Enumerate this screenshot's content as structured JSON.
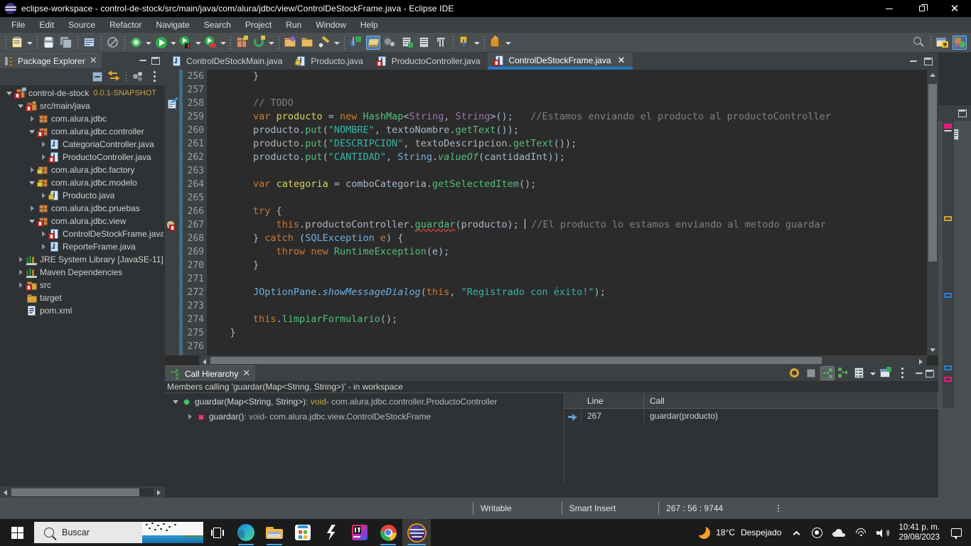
{
  "window": {
    "title": "eclipse-workspace - control-de-stock/src/main/java/com/alura/jdbc/view/ControlDeStockFrame.java - Eclipse IDE",
    "app_icon": "eclipse-icon",
    "minimize_label": "Minimize",
    "restore_label": "Restore",
    "close_label": "Close"
  },
  "menubar": {
    "items": [
      {
        "label": "File",
        "mnemonic": "F"
      },
      {
        "label": "Edit",
        "mnemonic": "E"
      },
      {
        "label": "Source",
        "mnemonic": "S"
      },
      {
        "label": "Refactor",
        "mnemonic": "t"
      },
      {
        "label": "Navigate",
        "mnemonic": "N"
      },
      {
        "label": "Search",
        "mnemonic": "a"
      },
      {
        "label": "Project",
        "mnemonic": "P"
      },
      {
        "label": "Run",
        "mnemonic": "R"
      },
      {
        "label": "Window",
        "mnemonic": "W"
      },
      {
        "label": "Help",
        "mnemonic": "H"
      }
    ]
  },
  "toolbar": {
    "icons": [
      "new-wizard-icon",
      "save-icon",
      "save-all-icon",
      "print-icon",
      "no-entry-icon",
      "debug-icon",
      "run-icon",
      "run-coverage-icon",
      "run-external-tools-icon",
      "new-java-project-icon",
      "refresh-icon",
      "open-type-icon",
      "open-task-icon",
      "edit-icon",
      "skip-breakpoints-icon",
      "java-perspective-icon",
      "search-icon",
      "next-annotation-icon",
      "previous-annotation-icon",
      "last-edit-location-icon",
      "back-icon",
      "forward-icon",
      "new-window-icon",
      "search-magnifier-icon",
      "open-perspective-icon",
      "java-ee-perspective-icon"
    ]
  },
  "package_explorer": {
    "tab_title": "Package Explorer",
    "tab_icon": "package-explorer-icon",
    "close_icon": "close-icon",
    "minimize_icon": "minimize-icon",
    "maximize_icon": "maximize-icon",
    "view_buttons": [
      "collapse-all-icon",
      "link-with-editor-icon",
      "view-menu-icon",
      "view-options-icon"
    ],
    "tree": [
      {
        "indent": 0,
        "twisty": "down",
        "icon": "java-project-error-icon",
        "label": "control-de-stock",
        "version": "0.0.1-SNAPSHOT"
      },
      {
        "indent": 1,
        "twisty": "down",
        "icon": "source-folder-error-icon",
        "label": "src/main/java",
        "version": ""
      },
      {
        "indent": 2,
        "twisty": "right",
        "icon": "package-icon",
        "label": "com.alura.jdbc",
        "version": ""
      },
      {
        "indent": 2,
        "twisty": "down",
        "icon": "package-error-icon",
        "label": "com.alura.jdbc.controller",
        "version": ""
      },
      {
        "indent": 3,
        "twisty": "right",
        "icon": "java-file-icon",
        "label": "CategoriaController.java",
        "version": ""
      },
      {
        "indent": 3,
        "twisty": "right",
        "icon": "java-file-error-icon",
        "label": "ProductoController.java",
        "version": ""
      },
      {
        "indent": 2,
        "twisty": "right",
        "icon": "package-lock-icon",
        "label": "com.alura.jdbc.factory",
        "version": ""
      },
      {
        "indent": 2,
        "twisty": "down",
        "icon": "package-lock-icon",
        "label": "com.alura.jdbc.modelo",
        "version": ""
      },
      {
        "indent": 3,
        "twisty": "right",
        "icon": "java-file-lock-icon",
        "label": "Producto.java",
        "version": ""
      },
      {
        "indent": 2,
        "twisty": "right",
        "icon": "package-icon",
        "label": "com.alura.jdbc.pruebas",
        "version": ""
      },
      {
        "indent": 2,
        "twisty": "down",
        "icon": "package-error-icon",
        "label": "com.alura.jdbc.view",
        "version": ""
      },
      {
        "indent": 3,
        "twisty": "right",
        "icon": "java-file-error-icon",
        "label": "ControlDeStockFrame.java",
        "version": ""
      },
      {
        "indent": 3,
        "twisty": "right",
        "icon": "java-file-icon",
        "label": "ReporteFrame.java",
        "version": ""
      },
      {
        "indent": 1,
        "twisty": "right",
        "icon": "library-icon",
        "label": "JRE System Library [JavaSE-11]",
        "version": ""
      },
      {
        "indent": 1,
        "twisty": "right",
        "icon": "library-icon",
        "label": "Maven Dependencies",
        "version": ""
      },
      {
        "indent": 1,
        "twisty": "right",
        "icon": "folder-error-icon",
        "label": "src",
        "version": ""
      },
      {
        "indent": 1,
        "twisty": "none",
        "icon": "folder-icon",
        "label": "target",
        "version": ""
      },
      {
        "indent": 1,
        "twisty": "none",
        "icon": "xml-file-icon",
        "label": "pom.xml",
        "version": ""
      }
    ]
  },
  "editor": {
    "tabs": [
      {
        "label": "ControlDeStockMain.java",
        "icon": "java-file-icon",
        "active": false,
        "closable": false
      },
      {
        "label": "Producto.java",
        "icon": "java-file-lock-icon",
        "active": false,
        "closable": false
      },
      {
        "label": "ProductoController.java",
        "icon": "java-file-error-icon",
        "active": false,
        "closable": false
      },
      {
        "label": "ControlDeStockFrame.java",
        "icon": "java-file-error-icon",
        "active": true,
        "closable": true
      }
    ],
    "close_icon": "close-icon",
    "minimize_icon": "minimize-icon",
    "maximize_icon": "maximize-icon",
    "first_line": 256,
    "lines": [
      {
        "n": 256,
        "marker": "",
        "segments": [
          {
            "t": "        }",
            "c": "pun"
          }
        ]
      },
      {
        "n": 257,
        "marker": "",
        "segments": []
      },
      {
        "n": 258,
        "marker": "todo-icon",
        "segments": [
          {
            "t": "        // TODO",
            "c": "cmt"
          }
        ]
      },
      {
        "n": 259,
        "marker": "",
        "segments": [
          {
            "t": "        ",
            "c": "pun"
          },
          {
            "t": "var",
            "c": "k"
          },
          {
            "t": " ",
            "c": "pun"
          },
          {
            "t": "producto",
            "c": "var"
          },
          {
            "t": " = ",
            "c": "pun"
          },
          {
            "t": "new",
            "c": "k"
          },
          {
            "t": " ",
            "c": "pun"
          },
          {
            "t": "HashMap",
            "c": "grn"
          },
          {
            "t": "<",
            "c": "pun"
          },
          {
            "t": "String",
            "c": "fld"
          },
          {
            "t": ", ",
            "c": "pun"
          },
          {
            "t": "String",
            "c": "fld"
          },
          {
            "t": ">();",
            "c": "pun"
          },
          {
            "t": "   //Estamos enviando el producto al productoController",
            "c": "cmt"
          }
        ]
      },
      {
        "n": 260,
        "marker": "",
        "segments": [
          {
            "t": "        producto.",
            "c": "pun"
          },
          {
            "t": "put",
            "c": "grn"
          },
          {
            "t": "(",
            "c": "pun"
          },
          {
            "t": "\"NOMBRE\"",
            "c": "tealk"
          },
          {
            "t": ", textoNombre.",
            "c": "pun"
          },
          {
            "t": "getText",
            "c": "grn"
          },
          {
            "t": "());",
            "c": "pun"
          }
        ]
      },
      {
        "n": 261,
        "marker": "",
        "segments": [
          {
            "t": "        producto.",
            "c": "pun"
          },
          {
            "t": "put",
            "c": "grn"
          },
          {
            "t": "(",
            "c": "pun"
          },
          {
            "t": "\"DESCRIPCION\"",
            "c": "tealk"
          },
          {
            "t": ", textoDescripcion.",
            "c": "pun"
          },
          {
            "t": "getText",
            "c": "grn"
          },
          {
            "t": "());",
            "c": "pun"
          }
        ]
      },
      {
        "n": 262,
        "marker": "",
        "segments": [
          {
            "t": "        producto.",
            "c": "pun"
          },
          {
            "t": "put",
            "c": "grn"
          },
          {
            "t": "(",
            "c": "pun"
          },
          {
            "t": "\"CANTIDAD\"",
            "c": "tealk"
          },
          {
            "t": ", ",
            "c": "pun"
          },
          {
            "t": "String",
            "c": "mth"
          },
          {
            "t": ".",
            "c": "pun"
          },
          {
            "t": "valueOf",
            "c": "grn-i"
          },
          {
            "t": "(cantidadInt));",
            "c": "pun"
          }
        ]
      },
      {
        "n": 263,
        "marker": "",
        "segments": []
      },
      {
        "n": 264,
        "marker": "",
        "segments": [
          {
            "t": "        ",
            "c": "pun"
          },
          {
            "t": "var",
            "c": "k"
          },
          {
            "t": " ",
            "c": "pun"
          },
          {
            "t": "categoria",
            "c": "var"
          },
          {
            "t": " = comboCategoria.",
            "c": "pun"
          },
          {
            "t": "getSelectedItem",
            "c": "grn"
          },
          {
            "t": "();",
            "c": "pun"
          }
        ]
      },
      {
        "n": 265,
        "marker": "",
        "segments": []
      },
      {
        "n": 266,
        "marker": "",
        "segments": [
          {
            "t": "        ",
            "c": "pun"
          },
          {
            "t": "try",
            "c": "k"
          },
          {
            "t": " {",
            "c": "pun"
          }
        ]
      },
      {
        "n": 267,
        "marker": "error-icon",
        "segments": [
          {
            "t": "            ",
            "c": "pun"
          },
          {
            "t": "this",
            "c": "k"
          },
          {
            "t": ".productoController.",
            "c": "pun"
          },
          {
            "t": "guardar",
            "c": "grn-u"
          },
          {
            "t": "(producto); ",
            "c": "pun"
          },
          {
            "t": "CARET",
            "c": "caret"
          },
          {
            "t": " //El producto lo estamos enviando al metodo guardar",
            "c": "cmt"
          }
        ]
      },
      {
        "n": 268,
        "marker": "",
        "segments": [
          {
            "t": "        } ",
            "c": "pun"
          },
          {
            "t": "catch",
            "c": "k"
          },
          {
            "t": " (",
            "c": "pun"
          },
          {
            "t": "SQLException",
            "c": "mth"
          },
          {
            "t": " ",
            "c": "pun"
          },
          {
            "t": "e",
            "c": "k"
          },
          {
            "t": ") {",
            "c": "pun"
          }
        ]
      },
      {
        "n": 269,
        "marker": "",
        "segments": [
          {
            "t": "            ",
            "c": "pun"
          },
          {
            "t": "throw",
            "c": "k"
          },
          {
            "t": " ",
            "c": "pun"
          },
          {
            "t": "new",
            "c": "k"
          },
          {
            "t": " ",
            "c": "pun"
          },
          {
            "t": "RuntimeException",
            "c": "grn"
          },
          {
            "t": "(e);",
            "c": "pun"
          }
        ]
      },
      {
        "n": 270,
        "marker": "",
        "segments": [
          {
            "t": "        }",
            "c": "pun"
          }
        ]
      },
      {
        "n": 271,
        "marker": "",
        "segments": []
      },
      {
        "n": 272,
        "marker": "",
        "segments": [
          {
            "t": "        ",
            "c": "pun"
          },
          {
            "t": "JOptionPane",
            "c": "mth"
          },
          {
            "t": ".",
            "c": "pun"
          },
          {
            "t": "showMessageDialog",
            "c": "mthi"
          },
          {
            "t": "(",
            "c": "pun"
          },
          {
            "t": "this",
            "c": "k"
          },
          {
            "t": ", ",
            "c": "pun"
          },
          {
            "t": "\"Registrado con éxito!\"",
            "c": "tealk"
          },
          {
            "t": ");",
            "c": "pun"
          }
        ]
      },
      {
        "n": 273,
        "marker": "",
        "segments": []
      },
      {
        "n": 274,
        "marker": "",
        "segments": [
          {
            "t": "        ",
            "c": "pun"
          },
          {
            "t": "this",
            "c": "k"
          },
          {
            "t": ".",
            "c": "pun"
          },
          {
            "t": "limpiarFormulario",
            "c": "grn"
          },
          {
            "t": "();",
            "c": "pun"
          }
        ]
      },
      {
        "n": 275,
        "marker": "",
        "segments": [
          {
            "t": "    }",
            "c": "pun"
          }
        ]
      },
      {
        "n": 276,
        "marker": "",
        "segments": []
      }
    ]
  },
  "call_hierarchy": {
    "tab_title": "Call Hierarchy",
    "tab_icon": "call-hierarchy-icon",
    "close_icon": "close-icon",
    "description": "Members calling 'guardar(Map<String, String>)' - in workspace",
    "toolbar_icons": [
      "refresh-icon",
      "cancel-icon",
      "show-callers-icon",
      "show-callees-icon",
      "field-mode-icon",
      "menu-arrow-icon",
      "new-view-icon",
      "view-menu-icon",
      "minimize-icon",
      "maximize-icon"
    ],
    "tree": [
      {
        "indent": 0,
        "twisty": "down",
        "icon": "method-public-icon",
        "name": "guardar(Map<String, String>)",
        "ret": " : void",
        "owner": " - com.alura.jdbc.controller.ProductoController"
      },
      {
        "indent": 1,
        "twisty": "right",
        "icon": "method-private-icon",
        "name": "guardar()",
        "ret": " : void",
        "owner": " - com.alura.jdbc.view.ControlDeStockFrame"
      }
    ],
    "table": {
      "columns": [
        "Line",
        "Call"
      ],
      "rows": [
        {
          "arrow": "goto-arrow-icon",
          "line": "267",
          "call": "guardar(producto)"
        }
      ]
    }
  },
  "statusbar": {
    "writable": "Writable",
    "insert_mode": "Smart Insert",
    "position": "267 : 56 : 9744",
    "overflow_icon": "more-options-icon"
  },
  "taskbar": {
    "start_icon": "windows-start-icon",
    "search_placeholder": "Buscar",
    "search_icon": "search-icon",
    "task_view_icon": "task-view-icon",
    "apps": [
      {
        "name": "microsoft-edge-icon",
        "running": true,
        "active": false
      },
      {
        "name": "file-explorer-icon",
        "running": true,
        "active": false
      },
      {
        "name": "microsoft-store-icon",
        "running": false,
        "active": false
      },
      {
        "name": "lightshot-icon",
        "running": false,
        "active": false
      },
      {
        "name": "intellij-idea-icon",
        "running": false,
        "active": false
      },
      {
        "name": "google-chrome-icon",
        "running": true,
        "active": false
      },
      {
        "name": "eclipse-icon",
        "running": true,
        "active": true
      }
    ],
    "weather": {
      "icon": "moon-icon",
      "temperature": "18°C",
      "condition": "Despejado"
    },
    "tray_icons": [
      "show-hidden-icons-icon",
      "record-icon",
      "onedrive-icon",
      "wifi-icon",
      "volume-icon"
    ],
    "clock": {
      "time": "10:41 p. m.",
      "date": "29/08/2023"
    },
    "action_center_icon": "notifications-icon"
  },
  "colors": {
    "titlebar_bg": "#000000",
    "chrome_bg": "#3c4043",
    "toolbar_bg": "#4a4f52",
    "editor_bg": "#2b2b2b",
    "panel_bg": "#2f3234",
    "accent_blue": "#1f7fd0",
    "taskbar_bg": "#1b1b1b",
    "error_red": "#cc4040",
    "keyword_orange": "#cc7832",
    "string_teal": "#35b5a5",
    "comment_gray": "#808080"
  }
}
